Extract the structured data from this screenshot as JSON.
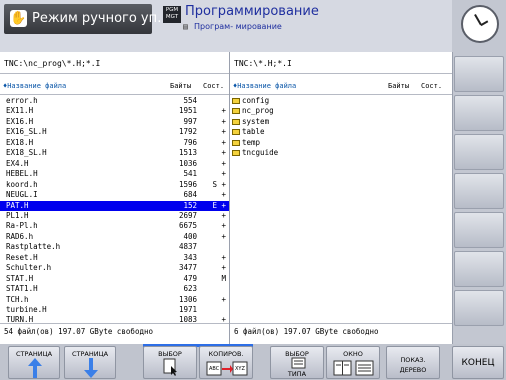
{
  "header": {
    "mode_title": "Режим ручного уп…",
    "pgm_box": "PGM\nMGT",
    "pgm_title": "Программирование",
    "pgm_sub": "Програм- мирование"
  },
  "left": {
    "path": "TNC:\\nc_prog\\*.H;*.I",
    "col_name": "♦Название файла",
    "col_bytes": "Байты",
    "col_state": "Сост.",
    "status": "54  файл(ов) 197.07 GByte свободно",
    "files": [
      {
        "name": "error.h",
        "size": "554",
        "state": ""
      },
      {
        "name": "EX11.H",
        "size": "1951",
        "state": "+"
      },
      {
        "name": "EX16.H",
        "size": "997",
        "state": "+"
      },
      {
        "name": "EX16_SL.H",
        "size": "1792",
        "state": "+"
      },
      {
        "name": "EX18.H",
        "size": "796",
        "state": "+"
      },
      {
        "name": "EX18_SL.H",
        "size": "1513",
        "state": "+"
      },
      {
        "name": "EX4.H",
        "size": "1036",
        "state": "+"
      },
      {
        "name": "HEBEL.H",
        "size": "541",
        "state": "+"
      },
      {
        "name": "koord.h",
        "size": "1596",
        "state": "S +"
      },
      {
        "name": "NEUGL.I",
        "size": "684",
        "state": "+"
      },
      {
        "name": "PAT.H",
        "size": "152",
        "state": "E +"
      },
      {
        "name": "PL1.H",
        "size": "2697",
        "state": "+"
      },
      {
        "name": "Ra-Pl.h",
        "size": "6675",
        "state": "+"
      },
      {
        "name": "RAD6.h",
        "size": "400",
        "state": "+"
      },
      {
        "name": "Rastplatte.h",
        "size": "4837",
        "state": ""
      },
      {
        "name": "Reset.H",
        "size": "343",
        "state": "+"
      },
      {
        "name": "Schulter.h",
        "size": "3477",
        "state": "+"
      },
      {
        "name": "STAT.H",
        "size": "479",
        "state": "M"
      },
      {
        "name": "STAT1.H",
        "size": "623",
        "state": ""
      },
      {
        "name": "TCH.h",
        "size": "1306",
        "state": "+"
      },
      {
        "name": "turbine.H",
        "size": "1971",
        "state": ""
      },
      {
        "name": "TURN.H",
        "size": "1083",
        "state": "+"
      }
    ]
  },
  "right": {
    "path": "TNC:\\*.H;*.I",
    "col_name": "♦Название файла",
    "col_bytes": "Байты",
    "col_state": "Сост.",
    "status": "6   файл(ов) 197.07 GByte свободно",
    "dirs": [
      "config",
      "nc_prog",
      "system",
      "table",
      "temp",
      "tncguide"
    ]
  },
  "softkeys": [
    {
      "line1": "СТРАНИЦА",
      "line2": "",
      "icon": "arrow-up-icon"
    },
    {
      "line1": "СТРАНИЦА",
      "line2": "",
      "icon": "arrow-down-icon"
    },
    {
      "line1": "ВЫБОР",
      "line2": "",
      "icon": "select-file-icon"
    },
    {
      "line1": "КОПИРОВ.",
      "line2": "ABC",
      "line3": "XYZ",
      "icon": "copy-icon"
    },
    {
      "line1": "ВЫБОР",
      "line2": "ТИПА",
      "icon": "select-type-icon"
    },
    {
      "line1": "ОКНО",
      "line2": "",
      "icon": "window-icon"
    },
    {
      "line1": "ПОКАЗ.",
      "line2": "ДЕРЕВО",
      "icon": ""
    },
    {
      "line1": "КОНЕЦ",
      "line2": "",
      "icon": ""
    }
  ],
  "colors": {
    "selection": "#0000ee",
    "accent": "#1f2f9f",
    "header_blue": "#0a56a8"
  }
}
